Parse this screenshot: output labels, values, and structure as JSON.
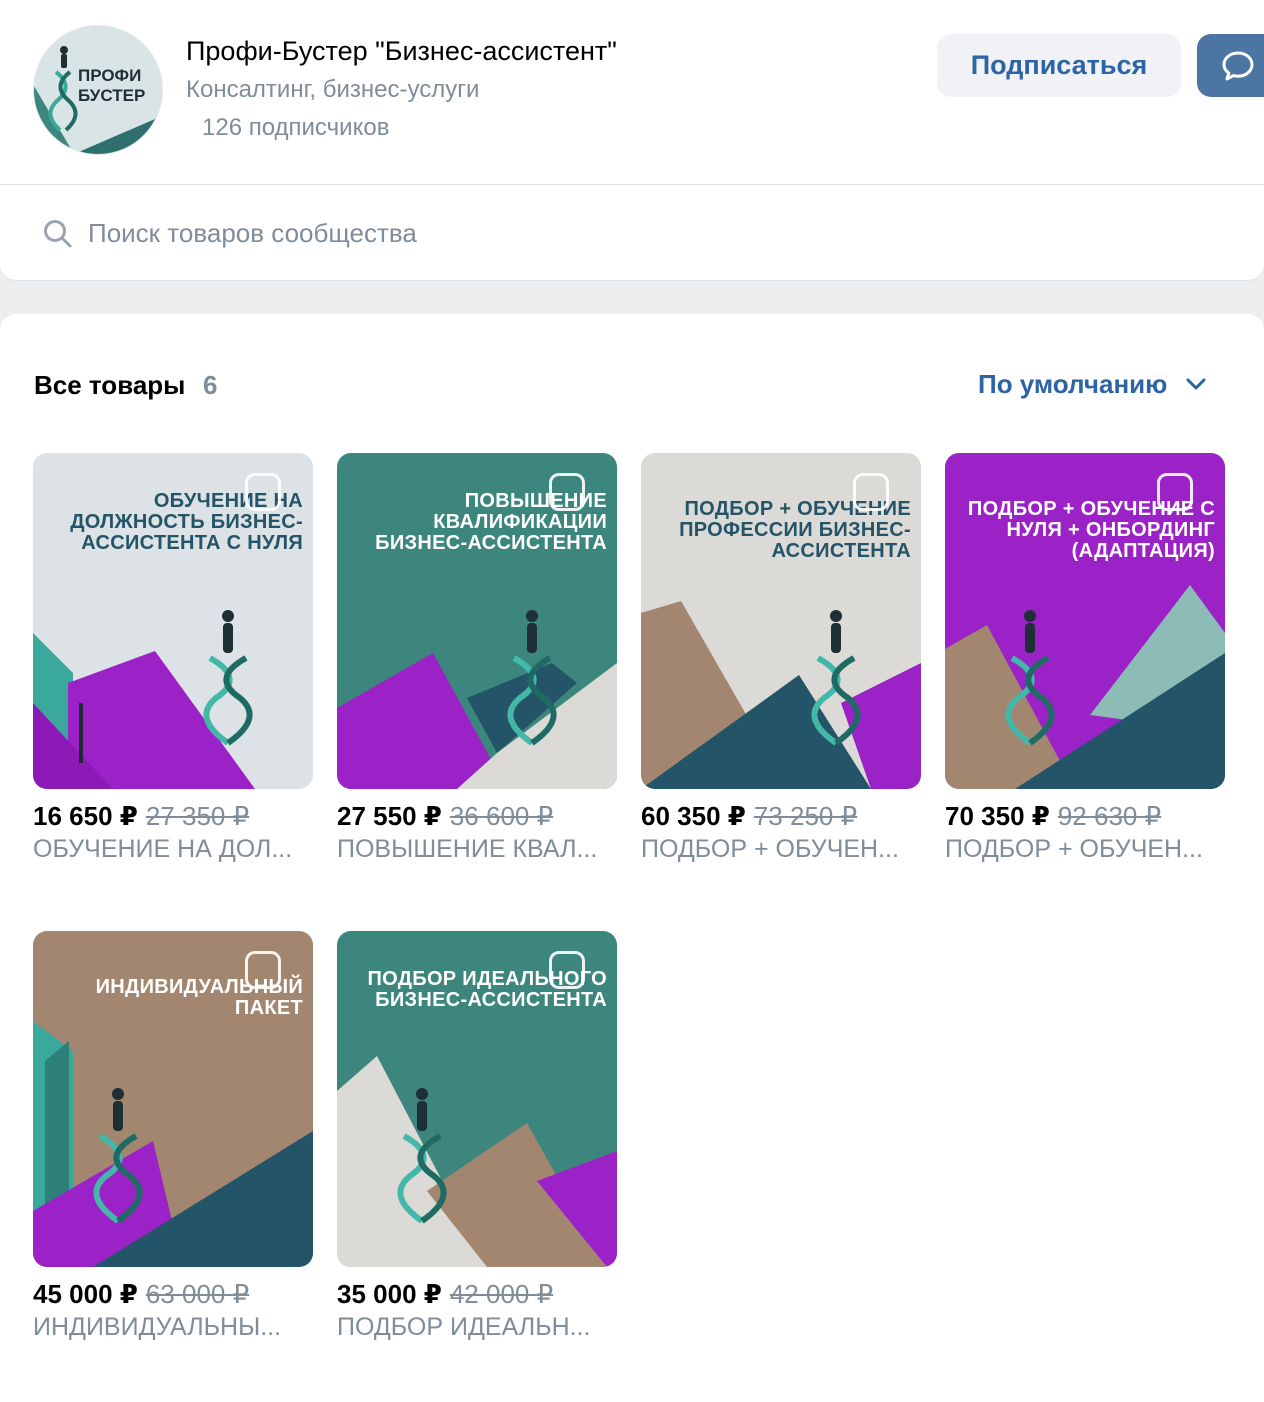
{
  "header": {
    "avatar_text": "ПРОФИ БУСТЕР",
    "title": "Профи-Бустер \"Бизнес-ассистент\"",
    "category": "Консалтинг, бизнес-услуги",
    "subscribers": "126 подписчиков",
    "subscribe_label": "Подписаться",
    "message_icon": "chat-bubble-icon"
  },
  "search": {
    "placeholder": "Поиск товаров сообщества",
    "icon": "search-icon"
  },
  "catalog": {
    "title": "Все товары",
    "count": "6",
    "sort_label": "По умолчанию",
    "products": [
      {
        "image_text": "ОБУЧЕНИЕ НА ДОЛЖНОСТЬ БИЗНЕС-АССИСТЕНТА С НУЛЯ",
        "price": "16 650 ₽",
        "old_price": "27 350 ₽",
        "name": "ОБУЧЕНИЕ НА ДОЛ..."
      },
      {
        "image_text": "ПОВЫШЕНИЕ КВАЛИФИКАЦИИ БИЗНЕС-АССИСТЕНТА",
        "price": "27 550 ₽",
        "old_price": "36 600 ₽",
        "name": "ПОВЫШЕНИЕ КВАЛ..."
      },
      {
        "image_text": "ПОДБОР + ОБУЧЕНИЕ ПРОФЕССИИ БИЗНЕС-АССИСТЕНТА",
        "price": "60 350 ₽",
        "old_price": "73 250 ₽",
        "name": "ПОДБОР + ОБУЧЕН..."
      },
      {
        "image_text": "ПОДБОР + ОБУЧЕНИЕ С НУЛЯ + ОНБОРДИНГ (АДАПТАЦИЯ)",
        "price": "70 350 ₽",
        "old_price": "92 630 ₽",
        "name": "ПОДБОР + ОБУЧЕН..."
      },
      {
        "image_text": "ИНДИВИДУАЛЬНЫЙ ПАКЕТ",
        "price": "45 000 ₽",
        "old_price": "63 000 ₽",
        "name": "ИНДИВИДУАЛЬНЫ..."
      },
      {
        "image_text": "ПОДБОР ИДЕАЛЬНОГО БИЗНЕС-АССИСТЕНТА",
        "price": "35 000 ₽",
        "old_price": "42 000 ₽",
        "name": "ПОДБОР ИДЕАЛЬН..."
      }
    ]
  },
  "colors": {
    "accent": "#2d64a6",
    "muted": "#818c99",
    "teal": "#3d867d",
    "purple": "#9b22c6",
    "navy": "#245467",
    "tan": "#a38670",
    "light": "#dce1e4"
  }
}
